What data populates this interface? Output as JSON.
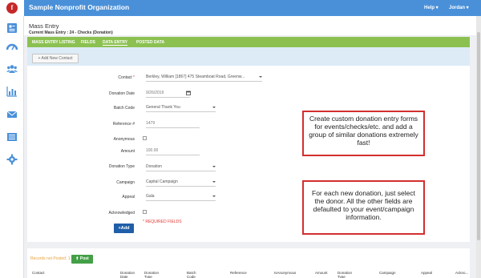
{
  "app": {
    "title": "Sample Nonprofit Organization",
    "logo_letter": "f"
  },
  "topbar": {
    "help_label": "Help ▾",
    "user_label": "Jordan ▾"
  },
  "sidebar": {
    "icons": [
      "home-icon",
      "dashboard-icon",
      "people-icon",
      "reports-icon",
      "mail-icon",
      "list-icon",
      "settings-icon"
    ]
  },
  "page": {
    "title": "Mass Entry",
    "subtitle": "Current Mass Entry : 24 - Checks (Donation)"
  },
  "tabs": [
    {
      "label": "MASS ENTRY LISTING"
    },
    {
      "label": "FIELDS"
    },
    {
      "label": "DATA ENTRY",
      "active": true
    },
    {
      "label": "POSTED DATA"
    }
  ],
  "toolbar": {
    "add_contact_label": "+ Add New Contact"
  },
  "form": {
    "contact": {
      "label": "Contact",
      "star": "*",
      "value": "Berkley, William [1867] 475 Steamboat Road, Greenw..."
    },
    "donation_date": {
      "label": "Donation Date",
      "value": "9/26/2019"
    },
    "batch_code": {
      "label": "Batch Code",
      "value": "General Thank You"
    },
    "reference": {
      "label": "Reference #",
      "value": "1479"
    },
    "anonymous": {
      "label": "Anonymous"
    },
    "amount": {
      "label": "Amount",
      "value": "100.00"
    },
    "donation_type": {
      "label": "Donation Type",
      "value": "Donation"
    },
    "campaign": {
      "label": "Campaign",
      "value": "Capital Campaign"
    },
    "appeal": {
      "label": "Appeal",
      "value": "Gala"
    },
    "acknowledged": {
      "label": "Acknowledged"
    },
    "required_note": "* REQUIRED FIELDS",
    "add_label": "+Add"
  },
  "callouts": [
    {
      "text": "Create custom donation entry forms for events/checks/etc. and add a group of similar donations extremely fast!"
    },
    {
      "text": "For each new donation, just select the donor. All the other fields are defaulted to your event/campaign information."
    }
  ],
  "bottom": {
    "tab_label": "Records not Posted: 1",
    "post_label": "Post",
    "columns": [
      "Contact",
      "Donation Date",
      "Donation Type",
      "Batch Code",
      "Reference",
      "IsAnonymous",
      "Amount",
      "Donation Type",
      "Campaign",
      "Appeal",
      "Ackno..."
    ]
  },
  "colors": {
    "topbar": "#4a90d9",
    "tabbar": "#8cc152",
    "add_button": "#1f5ea8",
    "callout_border": "#d32f2f",
    "post_button": "#43a047"
  }
}
